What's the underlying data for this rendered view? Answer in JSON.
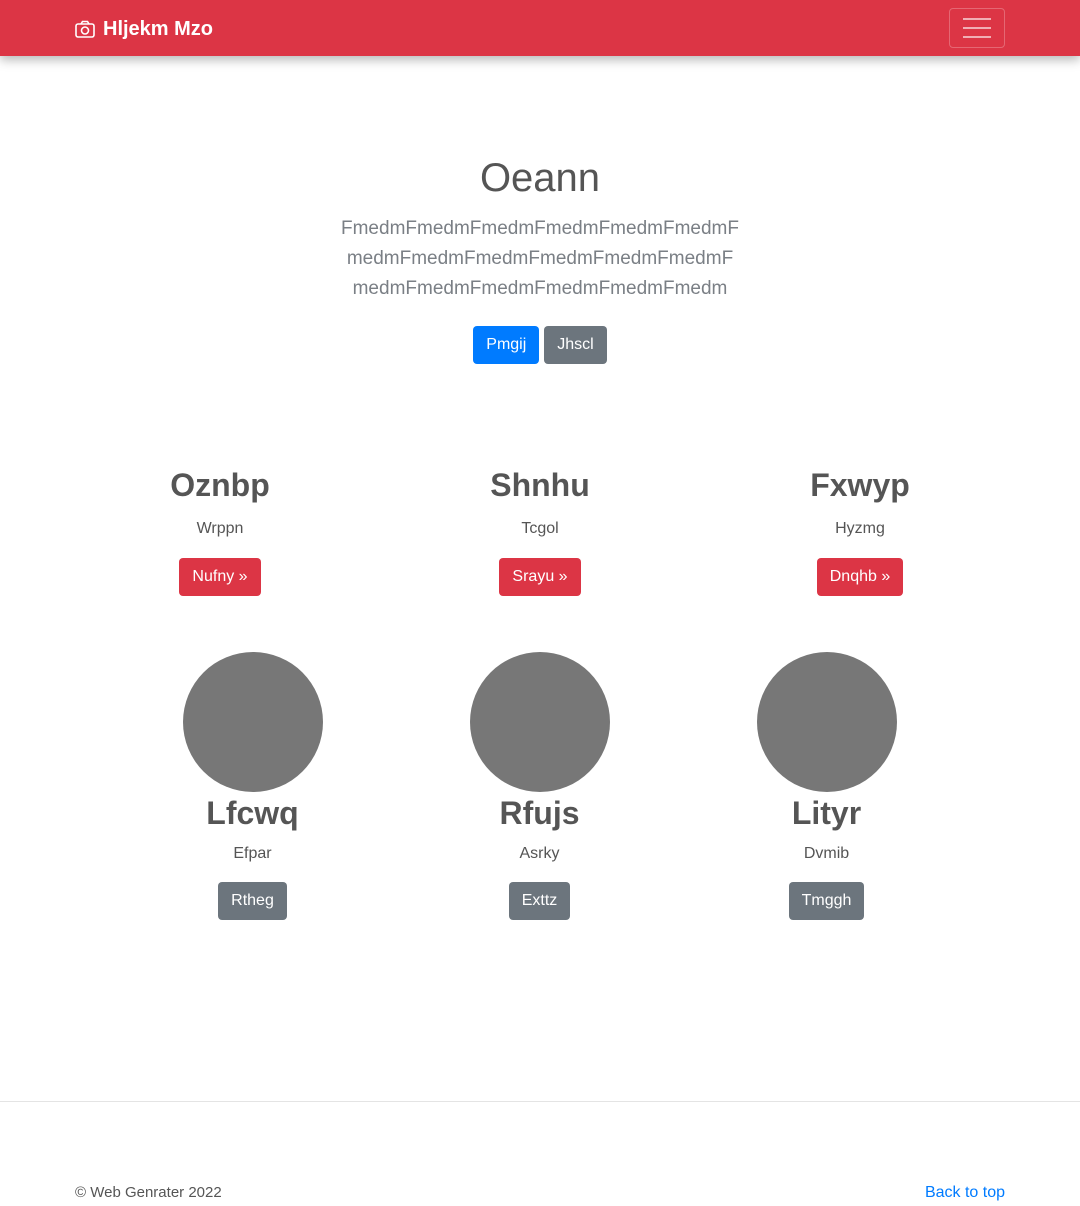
{
  "navbar": {
    "brand_icon": "camera-icon",
    "brand": "Hljekm Mzo",
    "menu_icon": "hamburger-menu-icon",
    "color": "#dc3545"
  },
  "hero": {
    "title": "Oeann",
    "lead": "FmedmFmedmFmedmFmedmFmedmFmedmFmedmFmedmFmedmFmedmFmedmFmedmFmedmFmedmFmedmFmedmFmedmFmedm",
    "primary_button": "Pmgij",
    "secondary_button": "Jhscl"
  },
  "features": [
    {
      "title": "Oznbp",
      "text": "Wrppn",
      "button": "Nufny »"
    },
    {
      "title": "Shnhu",
      "text": "Tcgol",
      "button": "Srayu »"
    },
    {
      "title": "Fxwyp",
      "text": "Hyzmg",
      "button": "Dnqhb »"
    }
  ],
  "profiles": [
    {
      "name": "Lfcwq",
      "text": "Efpar",
      "button": "Rtheg"
    },
    {
      "name": "Rfujs",
      "text": "Asrky",
      "button": "Exttz"
    },
    {
      "name": "Lityr",
      "text": "Dvmib",
      "button": "Tmggh"
    }
  ],
  "footer": {
    "copyright": "© Web Genrater 2022",
    "back_to_top": "Back to top"
  },
  "colors": {
    "primary": "#007bff",
    "secondary": "#6c757d",
    "danger": "#dc3545",
    "avatar": "#777777"
  }
}
